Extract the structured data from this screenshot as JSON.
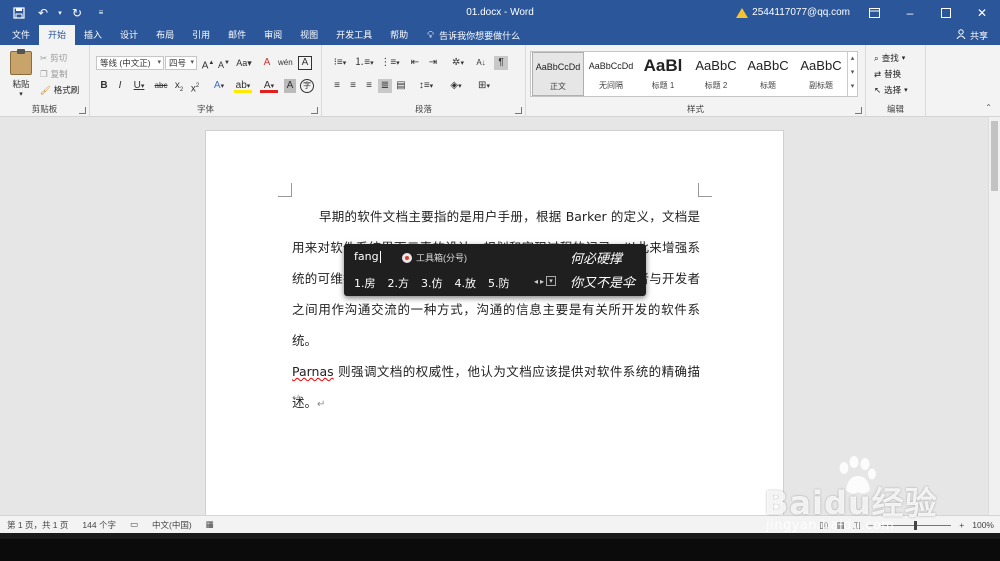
{
  "window": {
    "title": "01.docx - Word",
    "account": "2544117077@qq.com"
  },
  "tabs": [
    {
      "label": "文件"
    },
    {
      "label": "开始"
    },
    {
      "label": "插入"
    },
    {
      "label": "设计"
    },
    {
      "label": "布局"
    },
    {
      "label": "引用"
    },
    {
      "label": "邮件"
    },
    {
      "label": "审阅"
    },
    {
      "label": "视图"
    },
    {
      "label": "开发工具"
    },
    {
      "label": "帮助"
    }
  ],
  "tellme": "告诉我你想要做什么",
  "share": "共享",
  "ribbon": {
    "clipboard": {
      "label": "剪贴板",
      "paste": "粘贴",
      "cut": "剪切",
      "copy": "复制",
      "format_painter": "格式刷"
    },
    "font": {
      "label": "字体",
      "font_name": "等线 (中文正)",
      "font_size": "四号"
    },
    "paragraph": {
      "label": "段落"
    },
    "styles": {
      "label": "样式",
      "items": [
        {
          "preview": "AaBbCcDd",
          "name": "正文"
        },
        {
          "preview": "AaBbCcDd",
          "name": "无间隔"
        },
        {
          "preview": "AaBl",
          "name": "标题 1"
        },
        {
          "preview": "AaBbC",
          "name": "标题 2"
        },
        {
          "preview": "AaBbC",
          "name": "标题"
        },
        {
          "preview": "AaBbC",
          "name": "副标题"
        }
      ]
    },
    "editing": {
      "label": "编辑",
      "find": "查找",
      "replace": "替换",
      "select": "选择"
    }
  },
  "document": {
    "para1_prefix": "早期的软件文档主要指的是用户手册，根据 Barker 的定义，文档是用来对软件系统界面元素的设计、规划和实现过程的记录，以此来增强系统的可维护性和可用性。文档可以在开发者和用户之间，开发者与开发者之间用作沟通交流的一种方式，沟通的信息主要是有关所开发的软件系统。",
    "para2_word": "Parnas",
    "para2_rest": " 则强调文档的权威性，他认为文档应该提供对软件系统的精确描述。"
  },
  "ime": {
    "input": "fang",
    "toolbox": "工具箱(分号)",
    "candidates": [
      "1.房",
      "2.方",
      "3.仿",
      "4.放",
      "5.防"
    ],
    "hand_line1": "何必硬撑",
    "hand_line2": "你又不是伞"
  },
  "status": {
    "page": "第 1 页，共 1 页",
    "words": "144 个字",
    "language": "中文(中国)",
    "zoom": "100%"
  },
  "watermark": {
    "brand": "Baidu经验",
    "url": "jingyan.baidu.com"
  },
  "colors": {
    "word_blue": "#2b579a",
    "ribbon_bg": "#f3f3f3",
    "doc_bg": "#e6e6e6",
    "ime_bg": "#1f1f1f"
  }
}
